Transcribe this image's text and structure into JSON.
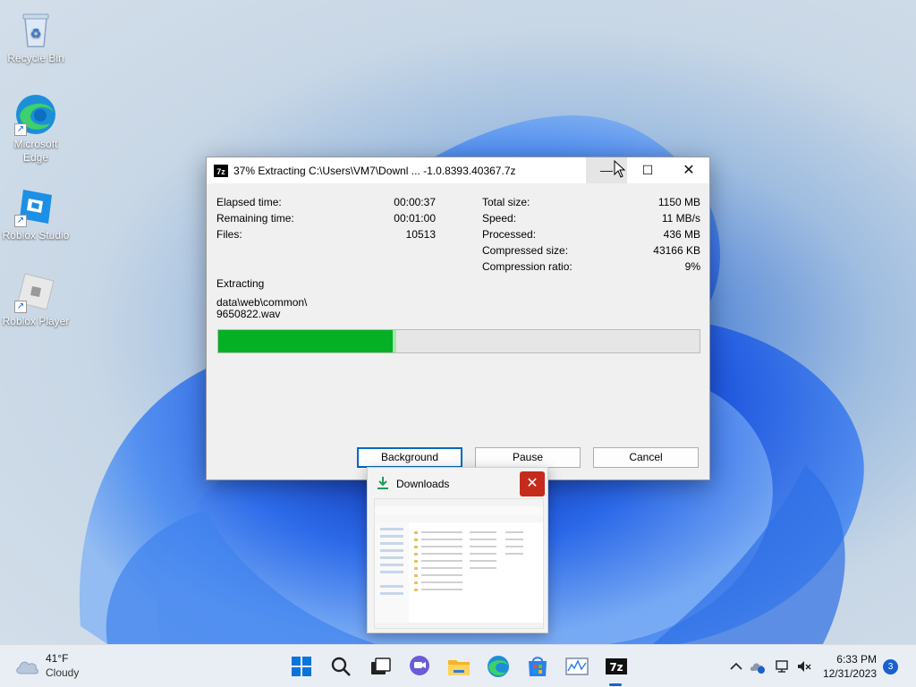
{
  "desktop": {
    "icons": [
      {
        "label": "Recycle Bin"
      },
      {
        "label": "Microsoft Edge"
      },
      {
        "label": "Roblox Studio"
      },
      {
        "label": "Roblox Player"
      }
    ]
  },
  "dialog": {
    "app_badge": "7z",
    "title": "37% Extracting C:\\Users\\VM7\\Downl ... -1.0.8393.40367.7z",
    "elapsed_label": "Elapsed time:",
    "elapsed_value": "00:00:37",
    "remaining_label": "Remaining time:",
    "remaining_value": "00:01:00",
    "files_label": "Files:",
    "files_value": "10513",
    "total_size_label": "Total size:",
    "total_size_value": "1150 MB",
    "speed_label": "Speed:",
    "speed_value": "11 MB/s",
    "processed_label": "Processed:",
    "processed_value": "436 MB",
    "compressed_label": "Compressed size:",
    "compressed_value": "43166 KB",
    "ratio_label": "Compression ratio:",
    "ratio_value": "9%",
    "status": "Extracting",
    "file_path_line1": "data\\web\\common\\",
    "file_path_line2": "9650822.wav",
    "progress_percent": 37,
    "buttons": {
      "background": "Background",
      "pause": "Pause",
      "cancel": "Cancel"
    }
  },
  "thumbnail": {
    "title": "Downloads"
  },
  "taskbar": {
    "weather_temp": "41°F",
    "weather_condition": "Cloudy",
    "clock_time": "6:33 PM",
    "clock_date": "12/31/2023",
    "notification_count": "3"
  },
  "colors": {
    "progress_fill": "#06b025",
    "accent": "#1a5fd0",
    "close_red": "#c42b1c"
  }
}
